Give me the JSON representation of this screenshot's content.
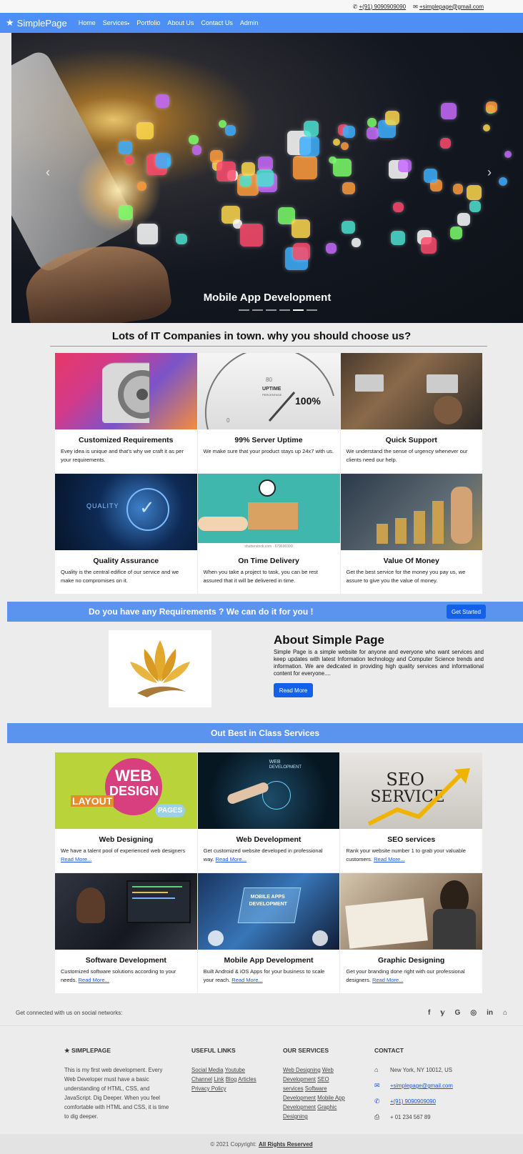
{
  "topbar": {
    "phone": "+(91) 9090909090",
    "email": "+simplepage@gmail.com",
    "phone_icon": "phone-icon",
    "email_icon": "envelope-icon"
  },
  "navbar": {
    "brand": "SimplePage",
    "brand_icon": "star-icon",
    "links": [
      "Home",
      "Services",
      "Portfolio",
      "About Us",
      "Contact Us",
      "Admin"
    ]
  },
  "hero": {
    "caption": "Mobile App Development",
    "indicator_count": 6,
    "active_indicator": 5
  },
  "why": {
    "title": "Lots of IT Companies in town. why you should choose us?",
    "cards": [
      {
        "title": "Customized Requirements",
        "text": "Evey idea is unique and that's why we craft it as per your requirements."
      },
      {
        "title": "99% Server Uptime",
        "text": "We make sure that your product stays up 24x7 with us."
      },
      {
        "title": "Quick Support",
        "text": "We understand the sense of urgency whenever our clients need our help."
      },
      {
        "title": "Quality Assurance",
        "text": "Quality is the central edifice of our service and we make no compromises on it."
      },
      {
        "title": "On Time Delivery",
        "text": "When you take a project to task, you can be rest assured that it will be delivered in time."
      },
      {
        "title": "Value Of Money",
        "text": "Get the best service for the money you pay us, we assure to give you the value of money."
      }
    ],
    "uptime_image": {
      "label": "UPTIME",
      "sublabel": "PERCENTAGE",
      "value": "100%",
      "tick_80": "80",
      "tick_0": "0"
    },
    "quality_image_label": "QUALITY",
    "delivery_image_caption": "shutterstock.com · 679690390"
  },
  "requirements": {
    "text": "Do you have any Requirements ? We can do it for you !",
    "button": "Get Started"
  },
  "about": {
    "title": "About Simple Page",
    "text": "Simple Page is a simple website for anyone and everyone who want services and keep updates with latest Information technology and Computer Science trends and information. We are dedicated in providing high quality services and informational content for everyone....",
    "button": "Read More"
  },
  "services": {
    "title": "Out Best in Class Services",
    "read_more": "Read More...",
    "cards": [
      {
        "title": "Web Designing",
        "text": "We have a talent pool of experienced web designers"
      },
      {
        "title": "Web Development",
        "text": "Get customized website developed in professional way."
      },
      {
        "title": "SEO services",
        "text": "Rank your website number 1 to grab your valuable customers."
      },
      {
        "title": "Software Development",
        "text": "Customized software solutions according to your needs."
      },
      {
        "title": "Mobile App Development",
        "text": "Built Android & iOS Apps for your business to scale your reach."
      },
      {
        "title": "Graphic Designing",
        "text": "Get your branding done right with our professional designers."
      }
    ],
    "web_design_image": {
      "word1": "WEB",
      "word2": "DESIGN",
      "word3": "LAYOUT",
      "word4": "PAGES"
    },
    "web_dev_image": {
      "word1": "WEB",
      "word2": "DEVELOPMENT"
    },
    "seo_image": {
      "word1": "SEO",
      "word2": "SERVICE"
    },
    "mobile_image": {
      "word1": "MOBILE APPS",
      "word2": "DEVELOPMENT"
    }
  },
  "social": {
    "text": "Get connected with us on social networks:",
    "icons": [
      "f",
      "𝕪",
      "G",
      "◎",
      "in",
      "⌂"
    ],
    "icon_names": [
      "facebook-icon",
      "twitter-icon",
      "google-icon",
      "instagram-icon",
      "linkedin-icon",
      "github-icon"
    ]
  },
  "footer": {
    "about_title": "SIMPLEPAGE",
    "about_text": "This is my first web development. Every Web Developer must have a basic understanding of HTML, CSS, and JavaScript. Dig Deeper. When you feel comfortable with HTML and CSS, it is time to dig deeper.",
    "links_title": "USEFUL LINKS",
    "links": [
      "Social Media",
      "Youtube",
      "Channel",
      "Link",
      "Blog",
      "Articles",
      "Privacy Policy"
    ],
    "services_title": "OUR SERVICES",
    "services": [
      "Web Designing",
      "Web Development",
      "SEO services",
      "Software Development",
      "Mobile App Development",
      "Graphic Designing"
    ],
    "contact_title": "CONTACT",
    "address": "New York, NY 10012, US",
    "email": "+simplepage@gmail.com",
    "phone": "+(91) 9090909090",
    "fax": "+ 01 234 567 89",
    "copyright_prefix": "© 2021 Copyright:",
    "copyright_link": "All Rights Reserved"
  },
  "colors": {
    "navbar": "#4d8ff5",
    "banner": "#5b94ee",
    "button": "#1361e8",
    "link": "#1a56d8"
  }
}
